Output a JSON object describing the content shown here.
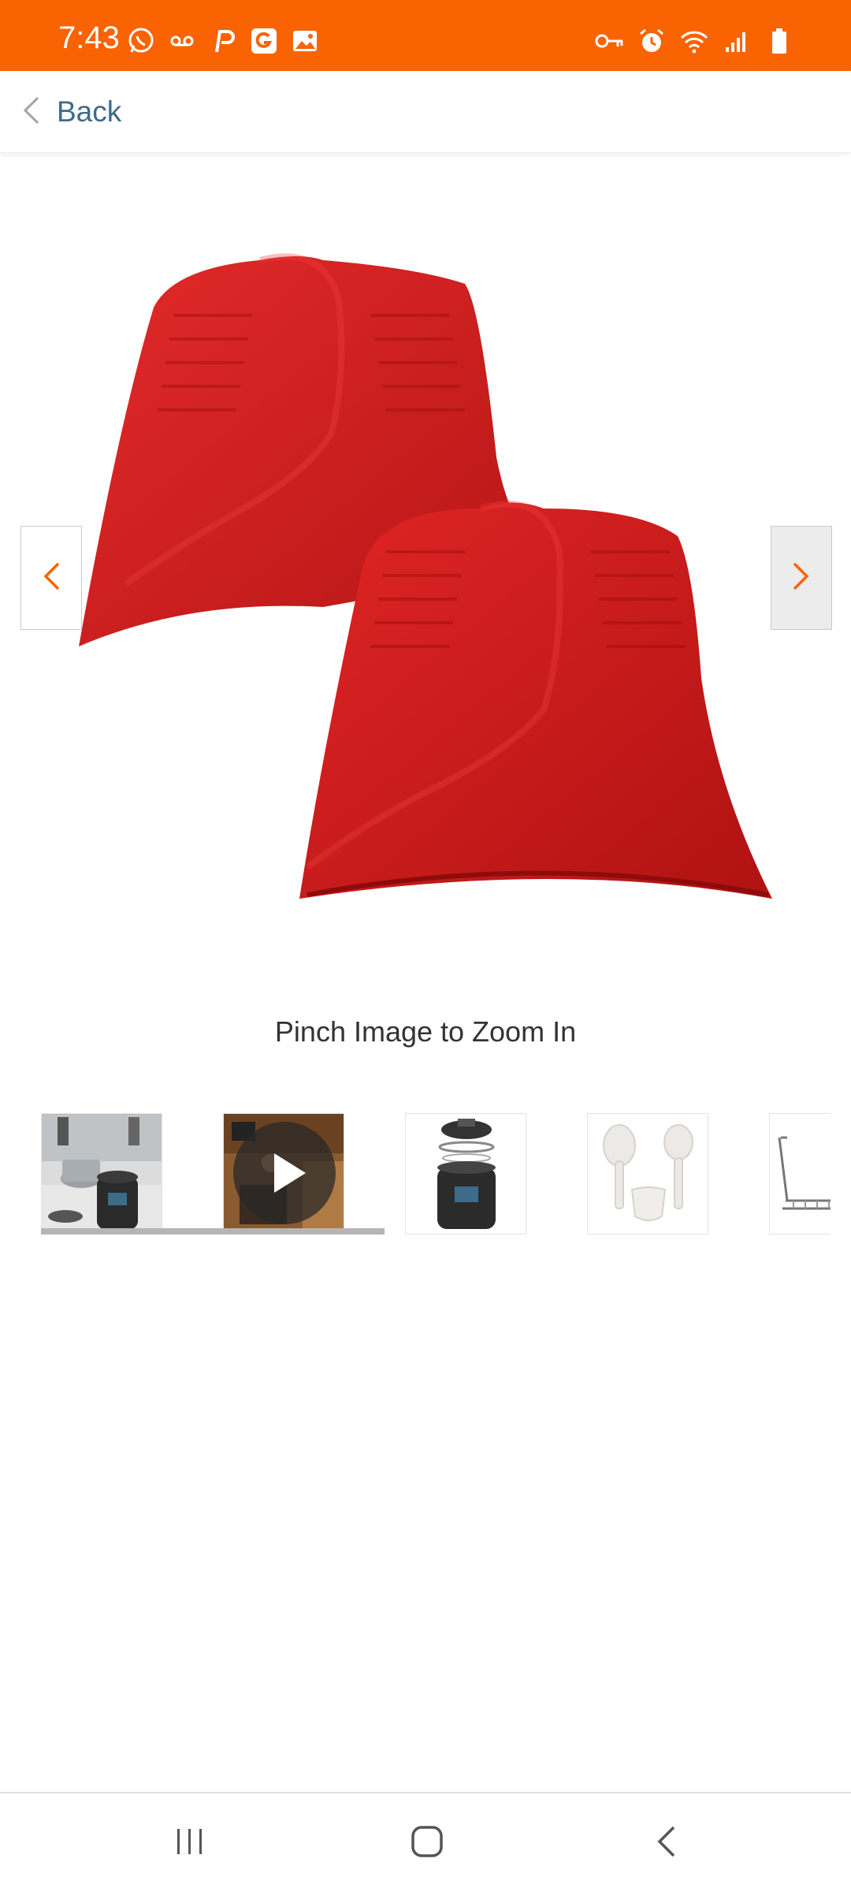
{
  "status_bar": {
    "time": "7:43",
    "background_color": "#f96302",
    "left_icons": [
      "whatsapp-icon",
      "voicemail-icon",
      "p-app-icon",
      "g-app-icon",
      "gallery-icon"
    ],
    "right_icons": [
      "vpn-key-icon",
      "alarm-icon",
      "wifi-icon",
      "signal-icon",
      "battery-icon"
    ]
  },
  "header": {
    "back_label": "Back",
    "back_color": "#3d6b8a"
  },
  "gallery": {
    "main_image_icon": "silicone-mitt-pair-image",
    "mitt_color": "#d71f1f",
    "accent_color": "#f96302",
    "zoom_hint": "Pinch Image to Zoom In",
    "thumbnails": [
      {
        "icon": "pressure-cooker-kitchen-photo",
        "selected": true
      },
      {
        "icon": "video-thumbnail-play-icon",
        "selected": false
      },
      {
        "icon": "pressure-cooker-exploded-photo",
        "selected": false
      },
      {
        "icon": "rice-paddle-spoon-cup-photo",
        "selected": false
      },
      {
        "icon": "steam-rack-photo",
        "selected": false
      }
    ]
  },
  "system_nav": {
    "icons": [
      "recent-apps-icon",
      "home-icon",
      "back-icon"
    ]
  }
}
